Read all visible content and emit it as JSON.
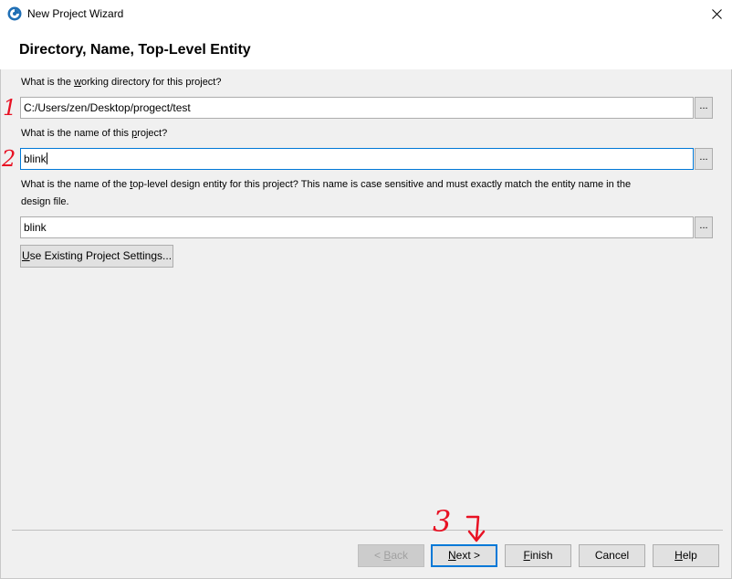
{
  "window": {
    "title": "New Project Wizard"
  },
  "page": {
    "title": "Directory, Name, Top-Level Entity"
  },
  "fields": {
    "directory": {
      "label_pre": "What is the ",
      "label_u": "w",
      "label_post": "orking directory for this project?",
      "value": "C:/Users/zen/Desktop/progect/test",
      "browse": "..."
    },
    "name": {
      "label_pre": "What is the name of this ",
      "label_u": "p",
      "label_post": "roject?",
      "value": "blink",
      "browse": "..."
    },
    "entity": {
      "label_pre": "What is the name of the ",
      "label_u": "t",
      "label_post": "op-level design entity for this project? This name is case sensitive and must exactly match the entity name in the",
      "label_line2": "design file.",
      "value": "blink",
      "browse": "..."
    }
  },
  "use_existing": {
    "u": "U",
    "rest": "se Existing Project Settings..."
  },
  "buttons": {
    "back": {
      "pre": "< ",
      "u": "B",
      "rest": "ack"
    },
    "next": {
      "u": "N",
      "rest": "ext >"
    },
    "finish": {
      "u": "F",
      "rest": "inish"
    },
    "cancel": {
      "label": "Cancel"
    },
    "help": {
      "u": "H",
      "rest": "elp"
    }
  },
  "annotations": {
    "one": "1",
    "two": "2",
    "three": "3",
    "color": "#e81123"
  },
  "colors": {
    "focus": "#0078d7"
  }
}
